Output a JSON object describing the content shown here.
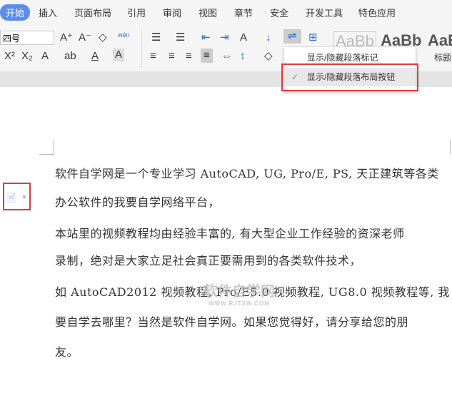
{
  "tabs": [
    "开始",
    "插入",
    "页面布局",
    "引用",
    "审阅",
    "视图",
    "章节",
    "安全",
    "开发工具",
    "特色应用"
  ],
  "toolbar": {
    "font_size": "四号",
    "pinyin": "wén",
    "style_previews": [
      "AaBb",
      "AaBb",
      "AaE"
    ],
    "style_label": "标题"
  },
  "menu": {
    "items": [
      {
        "label": "显示/隐藏段落标记",
        "checked": false
      },
      {
        "label": "显示/隐藏段落布局按钮",
        "checked": true
      }
    ]
  },
  "document": {
    "lines": [
      "软件自学网是一个专业学习 AutoCAD, UG, Pro/E, PS, 天正建筑等各类",
      "办公软件的我要自学网络平台，",
      "本站里的视频教程均由经验丰富的, 有大型企业工作经验的资深老师",
      "录制，绝对是大家立足社会真正要需用到的各类软件技术，",
      "如 AutoCAD2012 视频教程, Pro/E5.0 视频教程, UG8.0 视频教程等, 我",
      "要自学去哪里？当然是软件自学网。如果您觉得好，请分享给您的朋",
      "友。"
    ]
  },
  "watermark": {
    "title": "软件自学网",
    "url": "WWW.RJZXW.COM"
  },
  "colors": {
    "accent": "#5b8def",
    "highlight": "#e53935"
  }
}
